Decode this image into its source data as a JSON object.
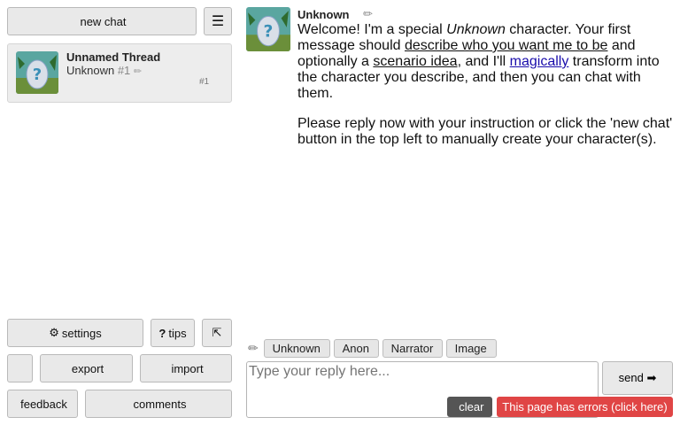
{
  "sidebar": {
    "new_chat_label": "new chat",
    "new_chat_icon": "",
    "menu_icon": "☰",
    "thread": {
      "title": "Unnamed Thread",
      "character": "Unknown",
      "char_num": "#1",
      "edit_icon": "✏",
      "count_label": "#1",
      "count_icon": "",
      "side_icons": [
        "",
        "",
        ""
      ]
    },
    "settings_label": "settings",
    "settings_icon": "⚙",
    "tips_label": "tips",
    "tips_icon": "?",
    "collapse_icon": "⇱",
    "misc_icon": "",
    "export_label": "export",
    "export_icon": "",
    "import_label": "import",
    "import_icon": "",
    "feedback_label": "feedback",
    "feedback_icon": "",
    "comments_label": "comments",
    "comments_icon": ""
  },
  "message": {
    "author": "Unknown",
    "tools": [
      "✏",
      "",
      "",
      ""
    ],
    "para1_a": "Welcome! I'm a special ",
    "para1_em": "Unknown",
    "para1_b": " character. Your first message should ",
    "para1_link1": "describe who you want me to be",
    "para1_c": " and optionally a ",
    "para1_link2": "scenario idea",
    "para1_d": ", and I'll ",
    "para1_link3": "magically",
    "para1_e": " transform into the character you describe, and then you can chat with them.",
    "para2": "Please reply now with your instruction or click the 'new chat' button in the top left to manually create your character(s)."
  },
  "composer": {
    "pencil_icon": "✏",
    "chips": [
      {
        "icon": "",
        "label": "Unknown"
      },
      {
        "icon": "",
        "label": "Anon"
      },
      {
        "icon": "",
        "label": "Narrator"
      },
      {
        "icon": "",
        "label": "Image"
      }
    ],
    "placeholder": "Type your reply here...",
    "send_label": "send ➡",
    "clear_label": "clear",
    "clear_icon": "",
    "error_label": "This page has errors (click here)"
  },
  "colors": {
    "error_bg": "#e04545",
    "clear_bg": "#555555",
    "link_blue": "#1a0dab"
  }
}
